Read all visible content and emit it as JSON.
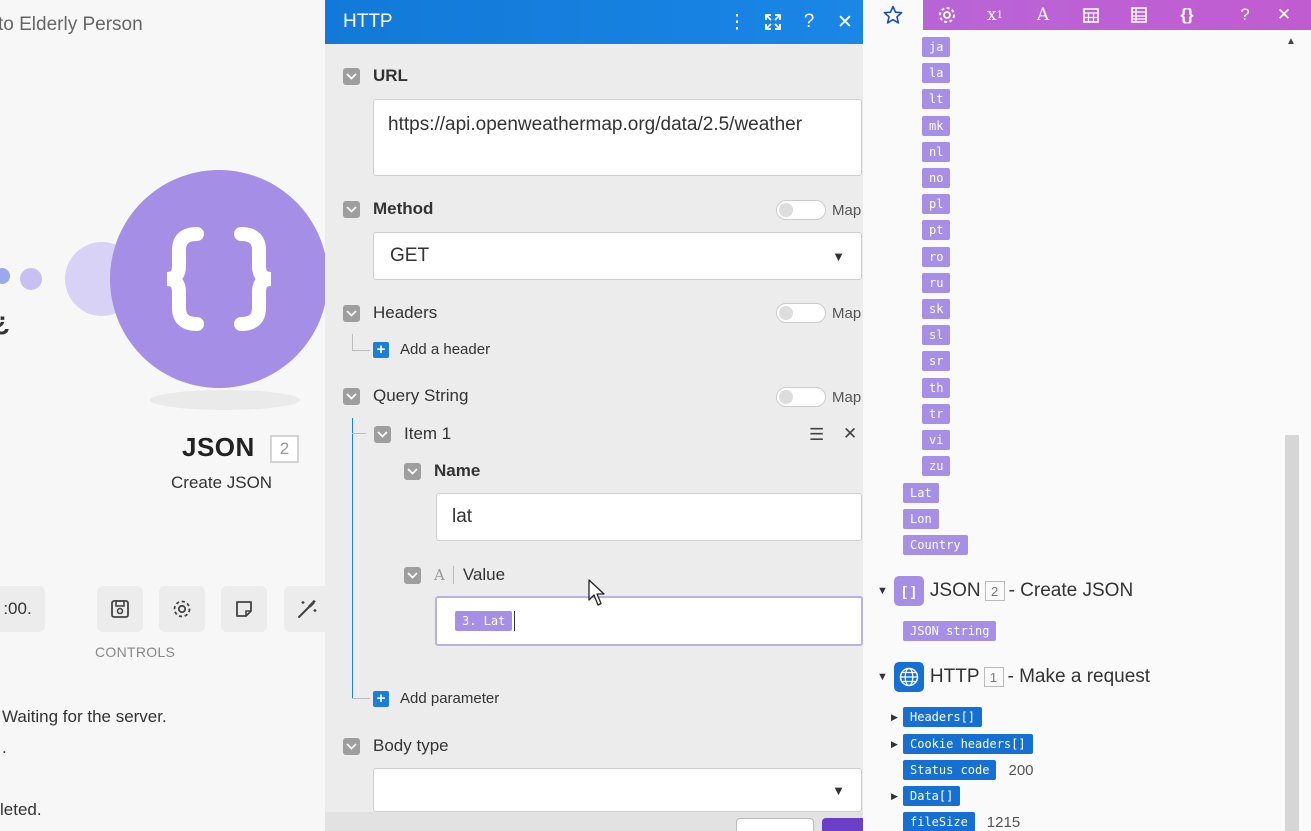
{
  "canvas": {
    "scenario_title": "to Elderly Person",
    "module": {
      "name": "JSON",
      "number": "2",
      "subtitle": "Create JSON",
      "color": "#a58fe6"
    },
    "schedule_text": ":00.",
    "controls_label": "CONTROLS",
    "log": [
      "Waiting for the server.",
      ".",
      "leted."
    ]
  },
  "http_panel": {
    "title": "HTTP",
    "header_color": "#1279d8",
    "url": {
      "label": "URL",
      "value": "https://api.openweathermap.org/data/2.5/weather"
    },
    "method": {
      "label": "Method",
      "value": "GET",
      "map_label": "Map"
    },
    "headers": {
      "label": "Headers",
      "map_label": "Map",
      "add_label": "Add a header"
    },
    "query_string": {
      "label": "Query String",
      "map_label": "Map",
      "item": {
        "label": "Item 1",
        "name_label": "Name",
        "name_value": "lat",
        "value_label": "Value",
        "value_pill": "3. Lat"
      },
      "add_label": "Add parameter"
    },
    "body_type": {
      "label": "Body type",
      "value": ""
    }
  },
  "mapper": {
    "accent": "#b766d8",
    "languages": [
      "ja",
      "la",
      "lt",
      "mk",
      "nl",
      "no",
      "pl",
      "pt",
      "ro",
      "ru",
      "sk",
      "sl",
      "sr",
      "th",
      "tr",
      "vi",
      "zu"
    ],
    "fields": [
      "Lat",
      "Lon",
      "Country"
    ],
    "json_module": {
      "title": "JSON",
      "number": "2",
      "subtitle": "- Create JSON",
      "items": [
        "JSON string"
      ]
    },
    "http_module": {
      "title": "HTTP",
      "number": "1",
      "subtitle": "- Make a request",
      "items": [
        {
          "label": "Headers[]",
          "value": "",
          "expandable": true
        },
        {
          "label": "Cookie headers[]",
          "value": "",
          "expandable": true
        },
        {
          "label": "Status code",
          "value": "200",
          "expandable": false
        },
        {
          "label": "Data[]",
          "value": "",
          "expandable": true
        },
        {
          "label": "fileSize",
          "value": "1215",
          "expandable": false
        }
      ]
    }
  }
}
